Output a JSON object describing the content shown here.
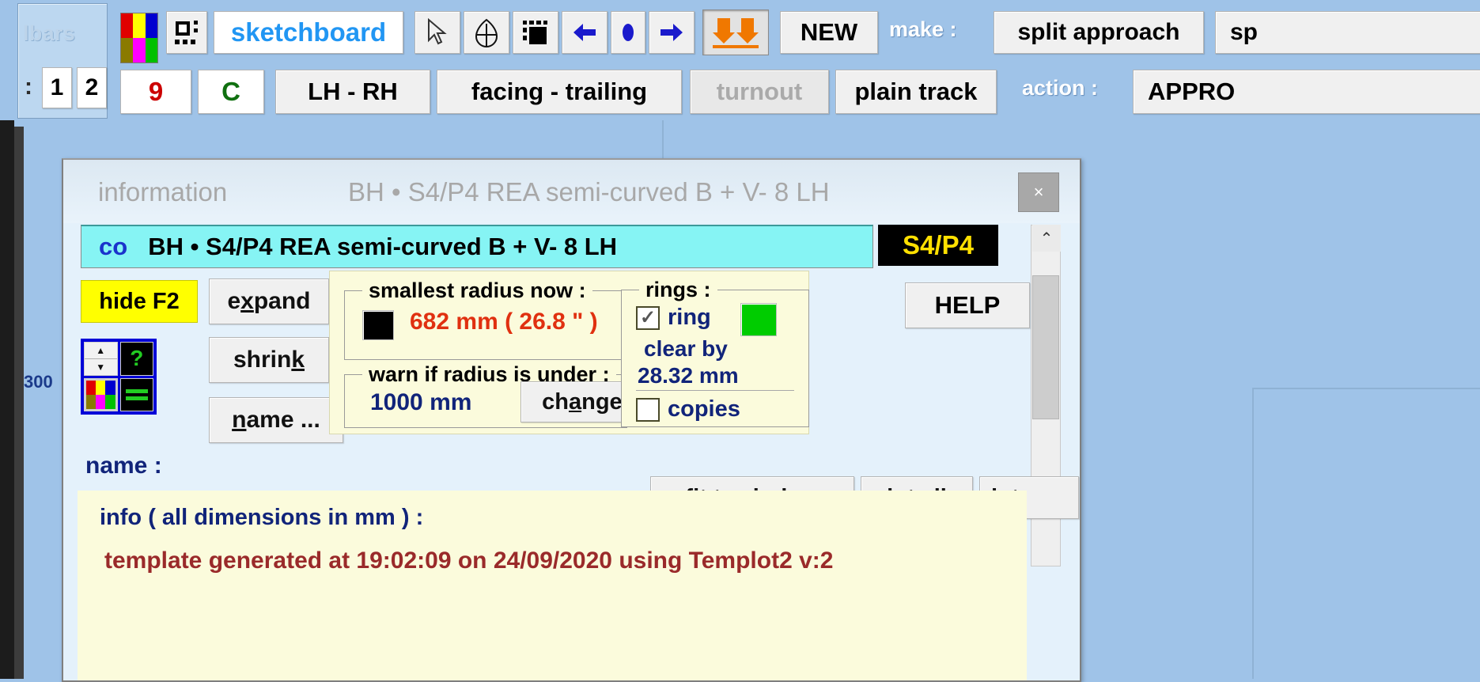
{
  "app": {
    "background_color": "#9fc3e8",
    "canvas_label": "300"
  },
  "toolbar": {
    "panel_label": "lbars",
    "row1": [
      {
        "name": "palette-swatch-icon",
        "label": ""
      },
      {
        "name": "select-box-icon",
        "label": ""
      },
      {
        "name": "sketchboard-button",
        "label": "sketchboard"
      },
      {
        "name": "pointer-icon",
        "label": ""
      },
      {
        "name": "target-icon",
        "label": ""
      },
      {
        "name": "marquee-icon",
        "label": ""
      },
      {
        "name": "arrow-left-icon",
        "label": ""
      },
      {
        "name": "dot-icon",
        "label": ""
      },
      {
        "name": "arrow-right-icon",
        "label": ""
      },
      {
        "name": "down-arrows-icon",
        "label": ""
      },
      {
        "name": "new-button",
        "label": "NEW"
      }
    ],
    "make_label": "make :",
    "make_buttons": [
      "split approach",
      "sp"
    ],
    "row2": {
      "tab_prefix": ":",
      "tabs": [
        "1",
        "2"
      ],
      "counter": "9",
      "letter": "C",
      "lh_rh": "LH - RH",
      "facing_trailing": "facing - trailing",
      "turnout": "turnout",
      "plain_track": "plain track",
      "action_label": "action :",
      "action_value": "APPRO"
    }
  },
  "dialog": {
    "title_left": "information",
    "title_right": "BH • S4/P4 REA semi-curved  B  +  V- 8   LH",
    "close_label": "×",
    "cyan_prefix": "co",
    "cyan_text": "BH • S4/P4 REA semi-curved  B  +  V- 8   LH",
    "badge": "S4/P4",
    "scroll_up_glyph": "⌃",
    "hide_button": "hide  F2",
    "expand_button": "expand",
    "expand_accel": "x",
    "shrink_button": "shrink",
    "shrink_accel": "k",
    "name_button": "name ...",
    "name_accel": "n",
    "help_button": "HELP",
    "smallest_radius": {
      "caption": "smallest radius now :",
      "value": "682 mm ( 26.8 \" )",
      "value_color": "#e03010"
    },
    "warn_radius": {
      "caption": "warn if radius is under :",
      "value": "1000 mm",
      "change_button": "change ..",
      "change_accel": "a"
    },
    "rings": {
      "caption": "rings :",
      "ring_checkbox_label": "ring",
      "ring_checked": true,
      "ring_color": "#00cc00",
      "clear_by_line1": "clear by",
      "clear_by_line2": "28.32 mm",
      "copies_checkbox_label": "copies",
      "copies_checked": false
    },
    "name_label": "name :",
    "info": {
      "header": "info ( all  dimensions  in  mm ) :",
      "line1": "template generated at 19:02:09 on 24/09/2020 using Templot2 v:2"
    },
    "bottom_buttons": [
      {
        "label": "fit to window",
        "accel": "w"
      },
      {
        "label": "jot all",
        "accel": "o"
      },
      {
        "label": "jot",
        "accel": "o"
      }
    ]
  }
}
